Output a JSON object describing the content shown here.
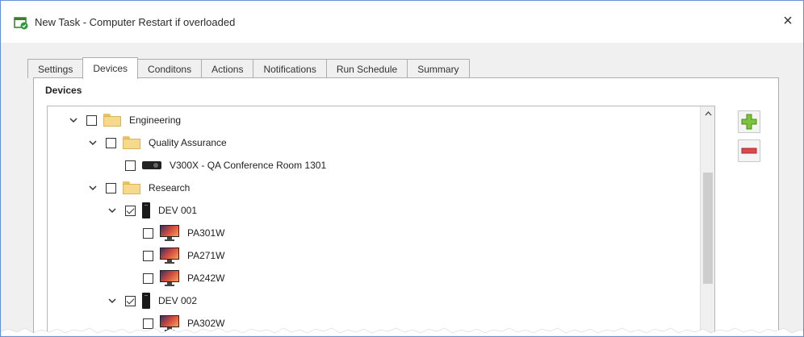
{
  "window": {
    "title": "New Task - Computer Restart if overloaded",
    "close_label": "×"
  },
  "tabs": [
    {
      "label": "Settings",
      "active": false
    },
    {
      "label": "Devices",
      "active": true
    },
    {
      "label": "Conditons",
      "active": false
    },
    {
      "label": "Actions",
      "active": false
    },
    {
      "label": "Notifications",
      "active": false
    },
    {
      "label": "Run Schedule",
      "active": false
    },
    {
      "label": "Summary",
      "active": false
    }
  ],
  "devices_group": {
    "label": "Devices",
    "tree": [
      {
        "label": "Engineering",
        "icon": "folder-icon",
        "checked": false,
        "expanded": true
      },
      {
        "label": "Quality Assurance",
        "icon": "folder-icon",
        "checked": false,
        "expanded": true
      },
      {
        "label": "V300X - QA Conference Room 1301",
        "icon": "projector-icon",
        "checked": false
      },
      {
        "label": "Research",
        "icon": "folder-icon",
        "checked": false,
        "expanded": true
      },
      {
        "label": "DEV 001",
        "icon": "computer-icon",
        "checked": true,
        "expanded": true
      },
      {
        "label": "PA301W",
        "icon": "monitor-icon",
        "checked": false
      },
      {
        "label": "PA271W",
        "icon": "monitor-icon",
        "checked": false
      },
      {
        "label": "PA242W",
        "icon": "monitor-icon",
        "checked": false
      },
      {
        "label": "DEV 002",
        "icon": "computer-icon",
        "checked": true,
        "expanded": true
      },
      {
        "label": "PA302W",
        "icon": "monitor-icon",
        "checked": false
      }
    ]
  },
  "side_buttons": {
    "add_icon": "plus-icon",
    "remove_icon": "minus-icon",
    "add_color": "#7cc23a",
    "remove_color": "#e0474c"
  },
  "colors": {
    "window_border": "#6a8fcf",
    "folder": "#f6d98a"
  }
}
